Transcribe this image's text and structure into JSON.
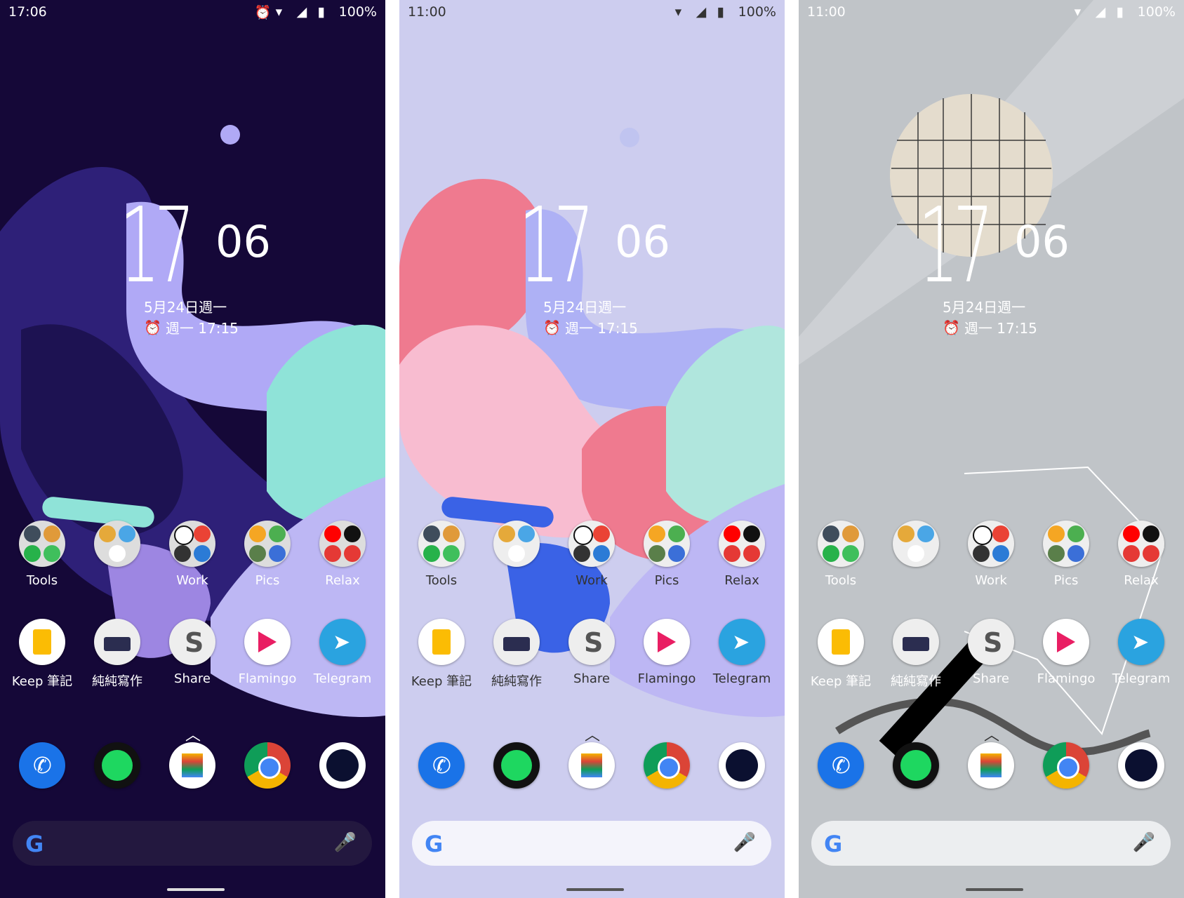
{
  "screens": [
    {
      "theme": "dark",
      "status": {
        "time": "17:06",
        "battery": "100%"
      },
      "clock": {
        "hour": "17",
        "minute": "06",
        "date": "5月24日週一",
        "alarm": "週一 17:15"
      },
      "folders": [
        {
          "label": "Tools"
        },
        {
          "label": ""
        },
        {
          "label": "Work"
        },
        {
          "label": "Pics"
        },
        {
          "label": "Relax"
        }
      ],
      "apps": [
        {
          "label": "Keep 筆記"
        },
        {
          "label": "純純寫作"
        },
        {
          "label": "Share"
        },
        {
          "label": "Flamingo"
        },
        {
          "label": "Telegram"
        }
      ]
    },
    {
      "theme": "light",
      "status": {
        "time": "11:00",
        "battery": "100%"
      },
      "clock": {
        "hour": "17",
        "minute": "06",
        "date": "5月24日週一",
        "alarm": "週一 17:15"
      },
      "folders": [
        {
          "label": "Tools"
        },
        {
          "label": ""
        },
        {
          "label": "Work"
        },
        {
          "label": "Pics"
        },
        {
          "label": "Relax"
        }
      ],
      "apps": [
        {
          "label": "Keep 筆記"
        },
        {
          "label": "純純寫作"
        },
        {
          "label": "Share"
        },
        {
          "label": "Flamingo"
        },
        {
          "label": "Telegram"
        }
      ]
    },
    {
      "theme": "gray",
      "status": {
        "time": "11:00",
        "battery": "100%"
      },
      "clock": {
        "hour": "17",
        "minute": "06",
        "date": "5月24日週一",
        "alarm": "週一 17:15"
      },
      "folders": [
        {
          "label": "Tools"
        },
        {
          "label": ""
        },
        {
          "label": "Work"
        },
        {
          "label": "Pics"
        },
        {
          "label": "Relax"
        }
      ],
      "apps": [
        {
          "label": "Keep 筆記"
        },
        {
          "label": "純純寫作"
        },
        {
          "label": "Share"
        },
        {
          "label": "Flamingo"
        },
        {
          "label": "Telegram"
        }
      ]
    }
  ],
  "dock": [
    "phone-icon",
    "spotify-icon",
    "tasks-icon",
    "chrome-icon",
    "camera-icon"
  ],
  "colors": {
    "dark_bg": "#150838",
    "light_bg": "#cdcdef",
    "gray_bg": "#c0c4c8",
    "mint": "#8fe3d8",
    "pink": "#ef7a8f",
    "blue": "#3a62e6"
  }
}
